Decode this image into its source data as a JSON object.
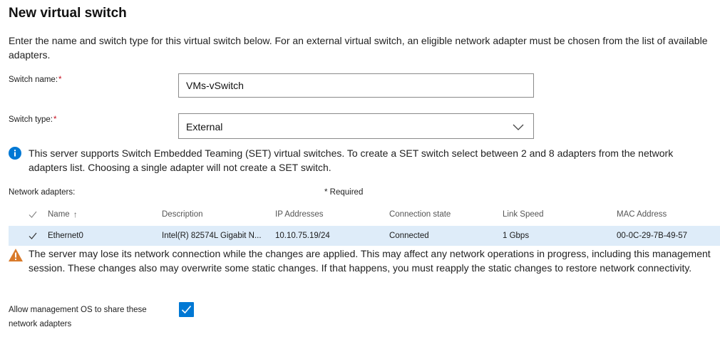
{
  "page": {
    "title": "New virtual switch",
    "intro": "Enter the name and switch type for this virtual switch below. For an external virtual switch, an eligible network adapter must be chosen from the list of available adapters."
  },
  "switch_name": {
    "label": "Switch name:",
    "required_mark": "*",
    "value": "VMs-vSwitch"
  },
  "switch_type": {
    "label": "Switch type:",
    "required_mark": "*",
    "value": "External"
  },
  "info": {
    "icon": "info-icon",
    "text": "This server supports Switch Embedded Teaming (SET) virtual switches. To create a SET switch select between 2 and 8 adapters from the network adapters list. Choosing a single adapter will not create a SET switch."
  },
  "adapters": {
    "label": "Network adapters:",
    "required_note": "* Required",
    "columns": {
      "name": "Name",
      "description": "Description",
      "ip": "IP Addresses",
      "connection": "Connection state",
      "link": "Link Speed",
      "mac": "MAC Address"
    },
    "rows": [
      {
        "name": "Ethernet0",
        "description": "Intel(R) 82574L Gigabit N...",
        "ip": "10.10.75.19/24",
        "connection": "Connected",
        "link": "1 Gbps",
        "mac": "00-0C-29-7B-49-57"
      }
    ]
  },
  "warning": {
    "icon": "warning-icon",
    "text": "The server may lose its network connection while the changes are applied. This may affect any network operations in progress, including this management session. These changes also may overwrite some static changes. If that happens, you must reapply the static changes to restore network connectivity."
  },
  "share": {
    "label": "Allow management OS to share these network adapters",
    "checked": true
  },
  "colors": {
    "accent": "#0078d4",
    "selected_row": "#deecf9",
    "required": "#c50f1f",
    "warning": "#d97a2a"
  }
}
